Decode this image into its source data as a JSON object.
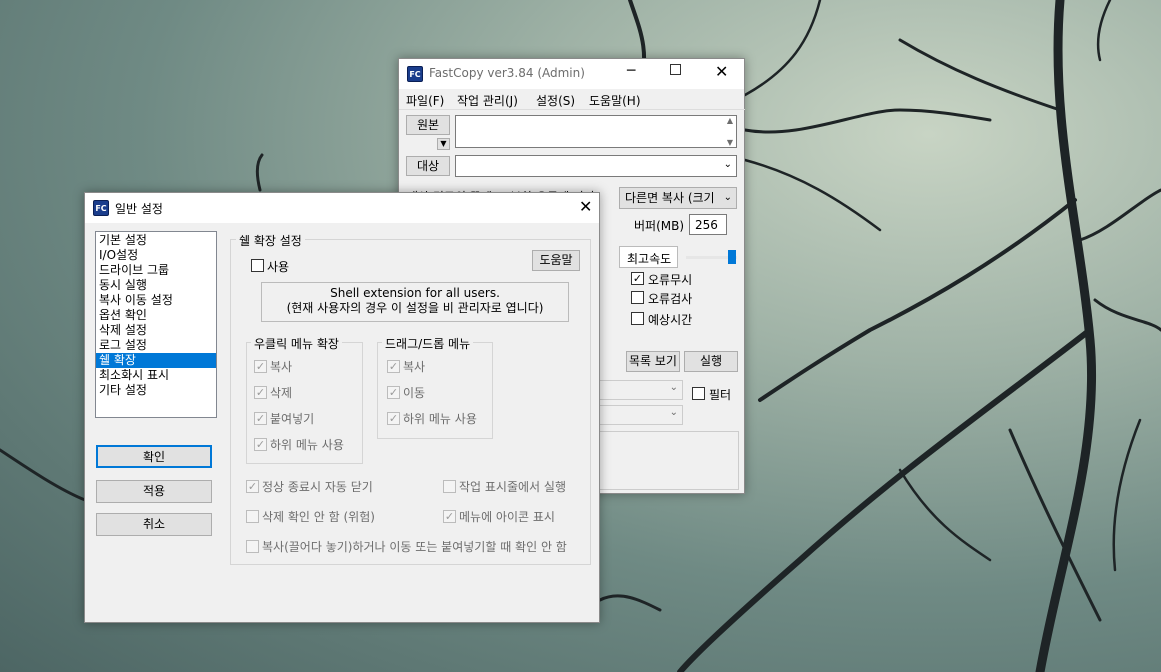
{
  "fastcopy": {
    "title": "FastCopy ver3.84 (Admin)",
    "icon_text": "FC",
    "menu": [
      "파일(F)",
      "작업 관리(J)",
      "설정(S)",
      "도움말(H)"
    ],
    "source_button": "원본",
    "dest_button": "대상",
    "truncated_label": "대상 경로의 끝에 '\\' 부착 유무에 따라",
    "mode_select": "다른면 복사 (크기",
    "buffer_label": "버퍼(MB)",
    "buffer_value": "256",
    "speed_label": "최고속도",
    "checks": [
      {
        "label": "오류무시",
        "checked": true
      },
      {
        "label": "오류검사",
        "checked": false
      },
      {
        "label": "예상시간",
        "checked": false
      }
    ],
    "list_button": "목록 보기",
    "execute_button": "실행",
    "filter_label": "필터"
  },
  "dialog": {
    "title": "일반 설정",
    "icon_text": "FC",
    "categories": [
      "기본 설정",
      "I/O설정",
      "드라이브 그룹",
      "동시 실행",
      "복사 이동 설정",
      "옵션 확인",
      "삭제 설정",
      "로그 설정",
      "쉘 확장",
      "최소화시 표시",
      "기타 설정"
    ],
    "selected_index": 8,
    "ok_button": "확인",
    "apply_button": "적용",
    "cancel_button": "취소",
    "group_title": "쉘 확장 설정",
    "use_label": "사용",
    "use_checked": false,
    "help_button": "도움말",
    "info_line1": "Shell extension for all users.",
    "info_line2": "(현재 사용자의 경우 이 설정을 비 관리자로 엽니다)",
    "right_menu_title": "우클릭 메뉴 확장",
    "right_menu_items": [
      {
        "label": "복사",
        "checked": true
      },
      {
        "label": "삭제",
        "checked": true
      },
      {
        "label": "붙여넣기",
        "checked": true
      },
      {
        "label": "하위 메뉴 사용",
        "checked": true
      }
    ],
    "drag_menu_title": "드래그/드롭 메뉴",
    "drag_menu_items": [
      {
        "label": "복사",
        "checked": true
      },
      {
        "label": "이동",
        "checked": true
      },
      {
        "label": "하위 메뉴 사용",
        "checked": true
      }
    ],
    "auto_close": {
      "label": "정상 종료시 자동 닫기",
      "checked": true
    },
    "taskbar_run": {
      "label": "작업 표시줄에서 실행",
      "checked": false
    },
    "no_delete_confirm": {
      "label": "삭제 확인 안 함 (위험)",
      "checked": false
    },
    "menu_icon": {
      "label": "메뉴에 아이콘 표시",
      "checked": true
    },
    "no_paste_confirm": {
      "label": "복사(끌어다 놓기)하거나 이동 또는 붙여넣기할 때 확인 안 함",
      "checked": false
    }
  }
}
